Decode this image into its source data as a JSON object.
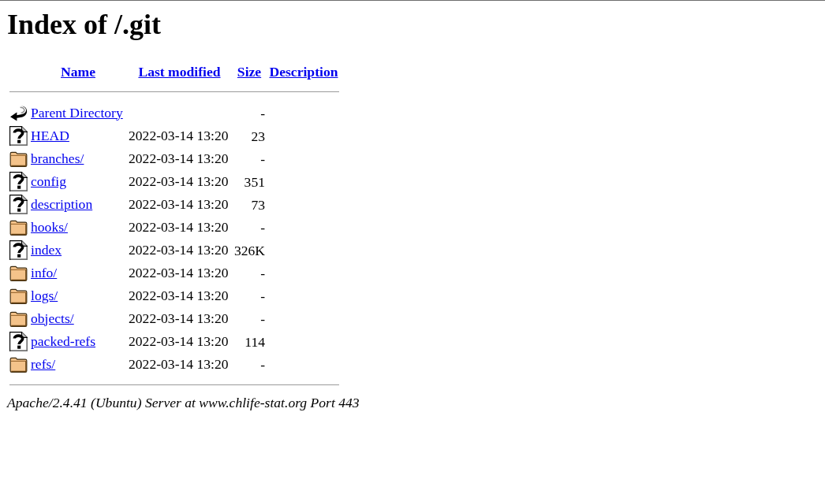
{
  "title": "Index of /.git",
  "columns": [
    "Name",
    "Last modified",
    "Size",
    "Description"
  ],
  "entries": [
    {
      "kind": "parent",
      "name": "Parent Directory",
      "size": "-"
    },
    {
      "kind": "file",
      "name": "HEAD",
      "modified": "2022-03-14 13:20",
      "size": "23"
    },
    {
      "kind": "folder",
      "name": "branches/",
      "modified": "2022-03-14 13:20",
      "size": "-"
    },
    {
      "kind": "file",
      "name": "config",
      "modified": "2022-03-14 13:20",
      "size": "351"
    },
    {
      "kind": "file",
      "name": "description",
      "modified": "2022-03-14 13:20",
      "size": "73"
    },
    {
      "kind": "folder",
      "name": "hooks/",
      "modified": "2022-03-14 13:20",
      "size": "-"
    },
    {
      "kind": "file",
      "name": "index",
      "modified": "2022-03-14 13:20",
      "size": "326K"
    },
    {
      "kind": "folder",
      "name": "info/",
      "modified": "2022-03-14 13:20",
      "size": "-"
    },
    {
      "kind": "folder",
      "name": "logs/",
      "modified": "2022-03-14 13:20",
      "size": "-"
    },
    {
      "kind": "folder",
      "name": "objects/",
      "modified": "2022-03-14 13:20",
      "size": "-"
    },
    {
      "kind": "file",
      "name": "packed-refs",
      "modified": "2022-03-14 13:20",
      "size": "114"
    },
    {
      "kind": "folder",
      "name": "refs/",
      "modified": "2022-03-14 13:20",
      "size": "-"
    }
  ],
  "footer": "Apache/2.4.41 (Ubuntu) Server at www.chlife-stat.org Port 443"
}
